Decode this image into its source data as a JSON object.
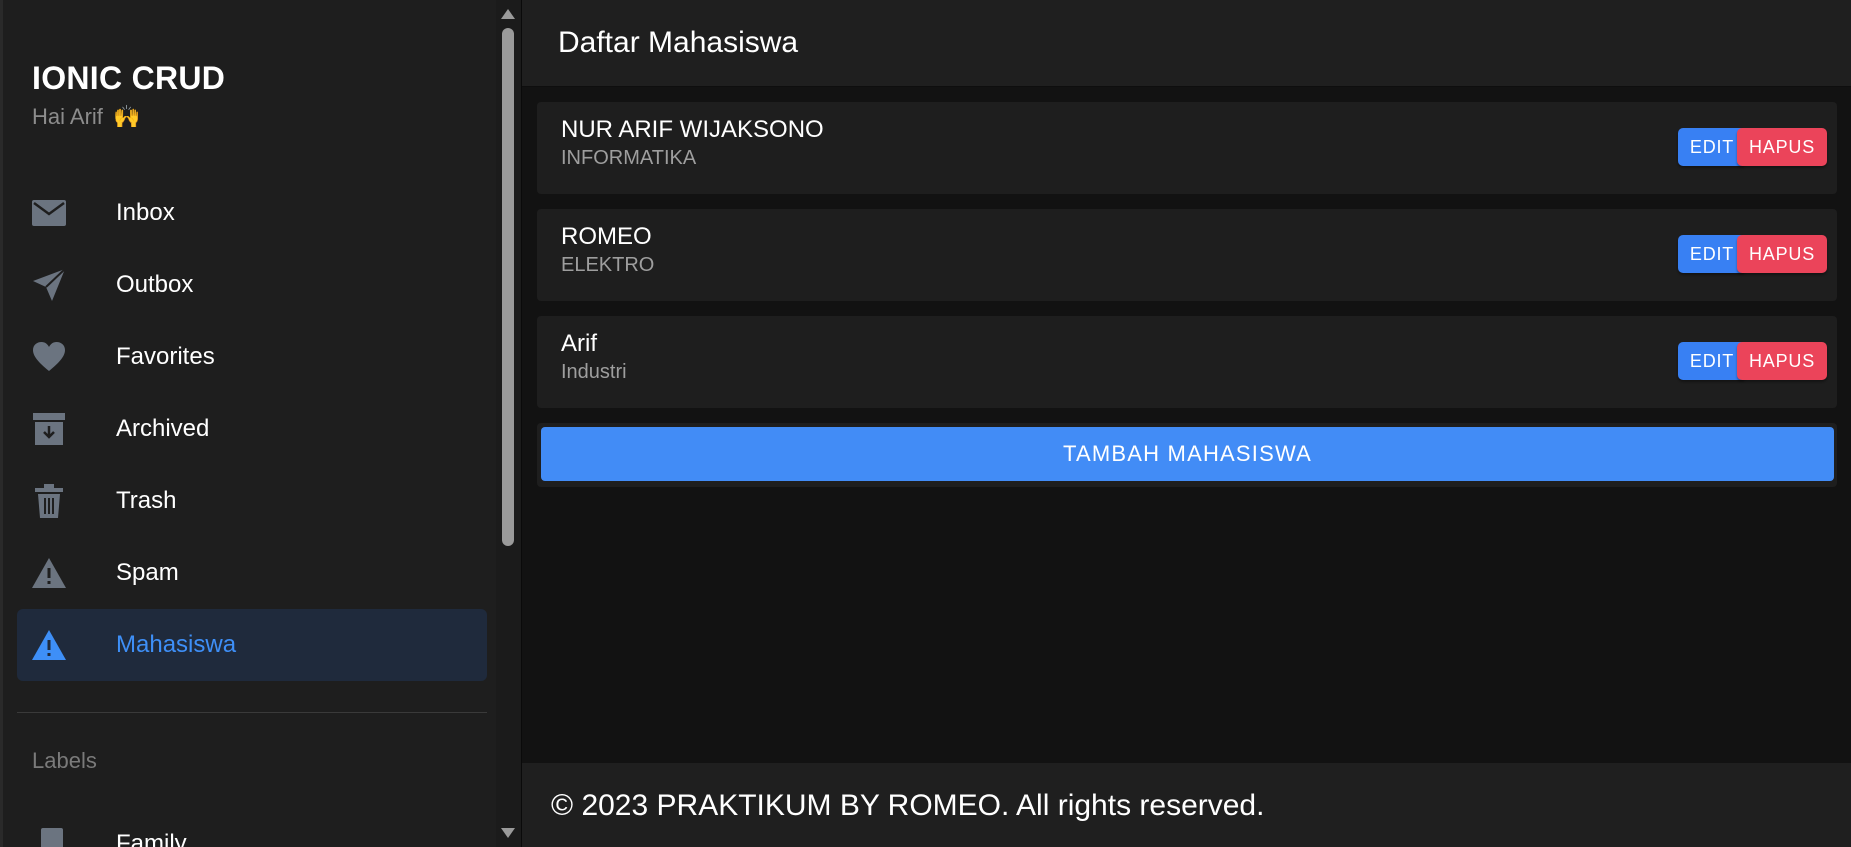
{
  "sidebar": {
    "app_title": "IONIC CRUD",
    "greeting": "Hai Arif",
    "greeting_emoji": "🙌",
    "items": [
      {
        "label": "Inbox",
        "icon": "mail-icon"
      },
      {
        "label": "Outbox",
        "icon": "paper-plane-icon"
      },
      {
        "label": "Favorites",
        "icon": "heart-icon"
      },
      {
        "label": "Archived",
        "icon": "archive-icon"
      },
      {
        "label": "Trash",
        "icon": "trash-icon"
      },
      {
        "label": "Spam",
        "icon": "warning-icon"
      },
      {
        "label": "Mahasiswa",
        "icon": "warning-icon",
        "active": true
      }
    ],
    "labels_heading": "Labels",
    "label_items": [
      {
        "label": "Family",
        "icon": "bookmark-icon"
      }
    ]
  },
  "header": {
    "title": "Daftar Mahasiswa"
  },
  "students": [
    {
      "name": "NUR ARIF WIJAKSONO",
      "department": "INFORMATIKA"
    },
    {
      "name": "ROMEO",
      "department": "ELEKTRO"
    },
    {
      "name": "Arif",
      "department": "Industri"
    }
  ],
  "buttons": {
    "edit_label": "EDIT",
    "delete_label": "HAPUS",
    "add_label": "TAMBAH MAHASISWA"
  },
  "footer": {
    "text": "© 2023 PRAKTIKUM BY ROMEO. All rights reserved."
  },
  "colors": {
    "primary": "#3880f3",
    "danger": "#eb445a",
    "active_text": "#3e8ff7",
    "icon_gray": "#6b7480"
  }
}
